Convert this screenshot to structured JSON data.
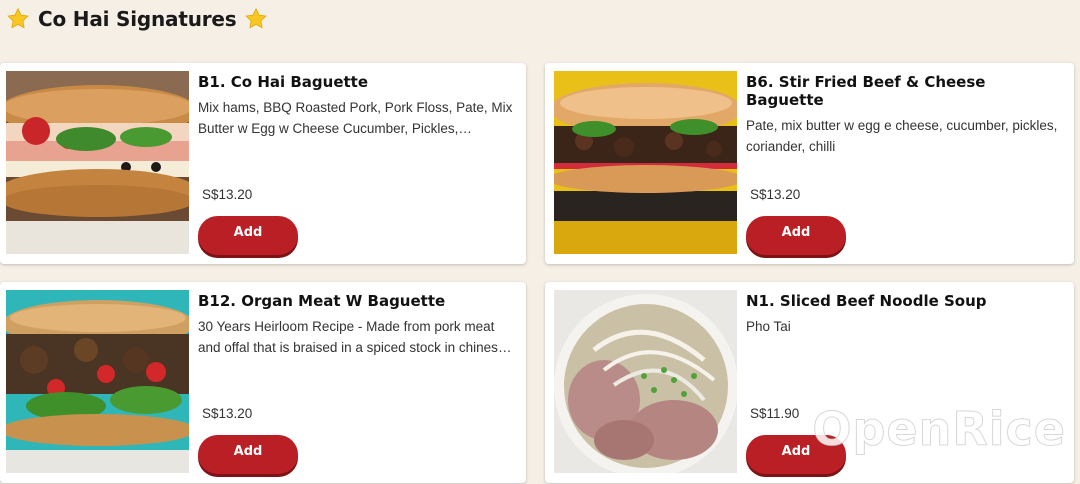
{
  "section": {
    "title": "Co Hai Signatures",
    "icons": [
      "star-icon",
      "star-icon"
    ]
  },
  "items": [
    {
      "name": "B1. Co Hai Baguette",
      "description": "Mix hams, BBQ Roasted Pork, Pork Floss, Pate, Mix Butter w Egg w Cheese Cucumber, Pickles, Coriander, Chilli",
      "price": "S$13.20",
      "add_label": "Add",
      "image": "baguette-ham-photo"
    },
    {
      "name": "B6. Stir Fried Beef & Cheese Baguette",
      "description": "Pate, mix butter w egg e cheese, cucumber, pickles, coriander, chilli",
      "price": "S$13.20",
      "add_label": "Add",
      "image": "baguette-beef-photo"
    },
    {
      "name": "B12. Organ Meat W Baguette",
      "description": "30 Years Heirloom Recipe - Made from pork meat and offal that is braised in a spiced stock in chinese herbs",
      "price": "S$13.20",
      "add_label": "Add",
      "image": "baguette-organ-photo"
    },
    {
      "name": "N1. Sliced Beef Noodle Soup",
      "description": "Pho Tai",
      "price": "S$11.90",
      "add_label": "Add",
      "image": "pho-bowl-photo"
    }
  ],
  "watermark": "OpenRice",
  "colors": {
    "background": "#f6efe6",
    "accent": "#b91f24",
    "card": "#ffffff"
  }
}
